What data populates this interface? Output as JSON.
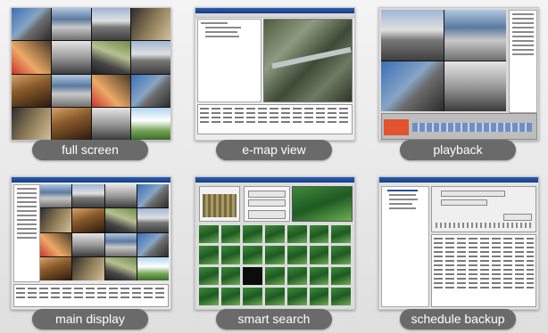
{
  "panels": [
    {
      "id": "full-screen",
      "label": "full screen"
    },
    {
      "id": "e-map-view",
      "label": "e-map view"
    },
    {
      "id": "playback",
      "label": "playback"
    },
    {
      "id": "main-display",
      "label": "main display"
    },
    {
      "id": "smart-search",
      "label": "smart search"
    },
    {
      "id": "schedule-backup",
      "label": "schedule backup"
    }
  ],
  "colors": {
    "label_pill": "#6a6a6a",
    "label_text": "#ffffff",
    "titlebar": "#2c5fb8",
    "background": "#e9e9e9"
  }
}
